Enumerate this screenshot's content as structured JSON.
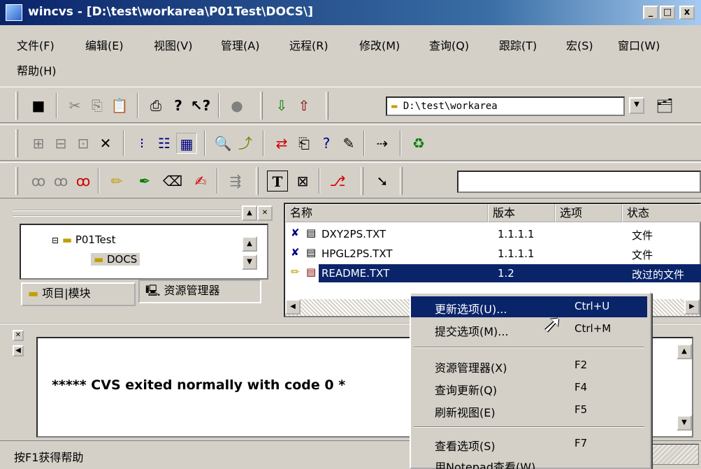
{
  "window": {
    "title": "wincvs - [D:\\test\\workarea\\P01Test\\DOCS\\]",
    "min_label": "_",
    "max_label": "□",
    "close_label": "x"
  },
  "menubar": {
    "items": [
      "文件(F)",
      "编辑(E)",
      "视图(V)",
      "管理(A)",
      "远程(R)",
      "修改(M)",
      "查询(Q)",
      "跟踪(T)",
      "宏(S)",
      "窗口(W)",
      "帮助(H)"
    ]
  },
  "toolbar": {
    "path_value": "D:\\test\\workarea"
  },
  "tree": {
    "items": [
      "P01Test",
      "DOCS"
    ],
    "tabs": [
      "项目|模块",
      "资源管理器"
    ]
  },
  "filelist": {
    "columns": [
      "名称",
      "版本",
      "选项",
      "状态"
    ],
    "rows": [
      {
        "name": "DXY2PS.TXT",
        "version": "1.1.1.1",
        "option": "",
        "status": "文件"
      },
      {
        "name": "HPGL2PS.TXT",
        "version": "1.1.1.1",
        "option": "",
        "status": "文件"
      },
      {
        "name": "README.TXT",
        "version": "1.2",
        "option": "",
        "status": "改过的文件"
      }
    ]
  },
  "output": {
    "text": "***** CVS exited normally with code 0 *"
  },
  "statusbar": {
    "text": "按F1获得帮助"
  },
  "context_menu": {
    "items": [
      {
        "label": "更新选项(U)...",
        "key": "Ctrl+U"
      },
      {
        "label": "提交选项(M)...",
        "key": "Ctrl+M"
      },
      {
        "label": "资源管理器(X)",
        "key": "F2"
      },
      {
        "label": "查询更新(Q)",
        "key": "F4"
      },
      {
        "label": "刷新视图(E)",
        "key": "F5"
      },
      {
        "label": "查看选项(S)",
        "key": "F7"
      },
      {
        "label": "用Notepad查看(W)",
        "key": ""
      }
    ]
  },
  "colors": {
    "selection": "#0a246a",
    "face": "#d4d0c8"
  }
}
